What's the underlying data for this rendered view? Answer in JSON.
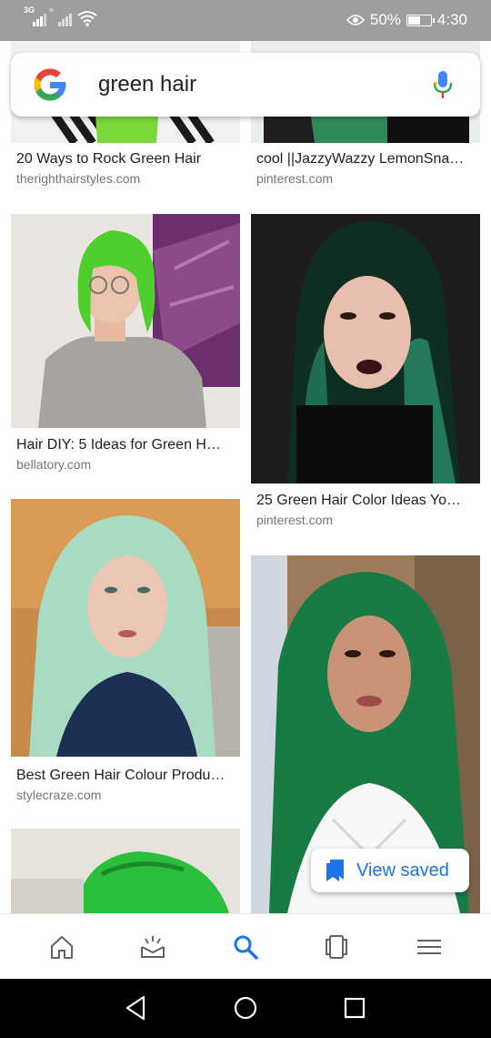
{
  "status_bar": {
    "network_label": "3G",
    "battery_percent": "50%",
    "battery_level": 0.5,
    "time": "4:30"
  },
  "search": {
    "query": "green hair"
  },
  "results": [
    {
      "title": "20 Ways to Rock Green Hair",
      "source": "therighthairstyles.com"
    },
    {
      "title": "cool ||JazzyWazzy LemonSna…",
      "source": "pinterest.com"
    },
    {
      "title": "Hair DIY: 5 Ideas for Green H…",
      "source": "bellatory.com"
    },
    {
      "title": "25 Green Hair Color Ideas Yo…",
      "source": "pinterest.com"
    },
    {
      "title": "Best Green Hair Colour Produ…",
      "source": "stylecraze.com"
    }
  ],
  "view_saved": {
    "label": "View saved"
  },
  "colors": {
    "accent": "#1a73e8",
    "status_bar": "#9e9e9e",
    "google_blue": "#4285F4",
    "google_red": "#EA4335",
    "google_yellow": "#FBBC05",
    "google_green": "#34A853"
  },
  "bottom_nav": {
    "items": [
      {
        "icon": "home-icon"
      },
      {
        "icon": "updates-icon"
      },
      {
        "icon": "search-icon",
        "active": true
      },
      {
        "icon": "tabs-icon"
      },
      {
        "icon": "menu-icon"
      }
    ]
  },
  "system_nav": {
    "items": [
      {
        "icon": "back-icon"
      },
      {
        "icon": "home-circle-icon"
      },
      {
        "icon": "recents-icon"
      }
    ]
  }
}
